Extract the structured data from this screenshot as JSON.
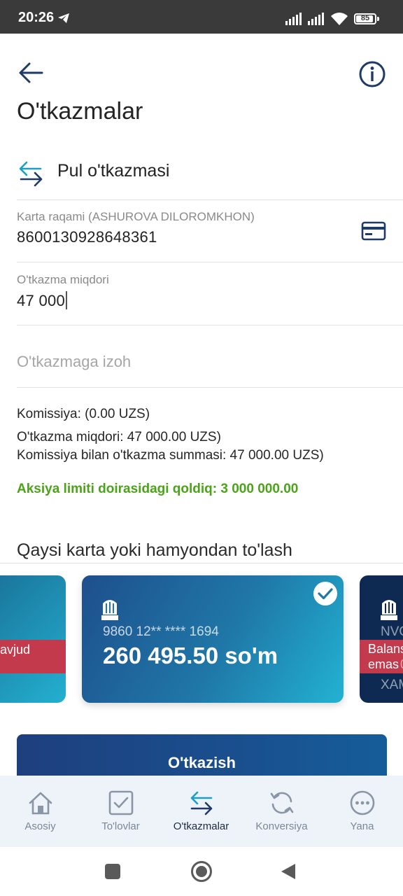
{
  "status_bar": {
    "time": "20:26",
    "battery": "85"
  },
  "header": {
    "title": "O'tkazmalar"
  },
  "section": {
    "title": "Pul o'tkazmasi"
  },
  "card_field": {
    "label": "Karta raqami (ASHUROVA DILOROMKHON)",
    "value": "8600130928648361"
  },
  "amount_field": {
    "label": "O'tkazma miqdori",
    "value": "47 000"
  },
  "comment_field": {
    "placeholder": "O'tkazmaga izoh"
  },
  "summary": {
    "commission": "Komissiya: (0.00 UZS)",
    "amount": "O'tkazma miqdori: 47 000.00 UZS)",
    "total": "Komissiya bilan o'tkazma summasi: 47 000.00 UZS)",
    "promo": "Aksiya limiti doirasidagi qoldiq: 3 000 000.00",
    "promo_color": "#4aa319"
  },
  "pay_from": {
    "heading": "Qaysi karta yoki hamyondan to'lash",
    "cards": [
      {
        "band_text": "avjud"
      },
      {
        "bank_logo": "NBU",
        "masked": "9860 12** **** 1694",
        "balance": "260 495.50 so'm",
        "selected": true
      },
      {
        "bank_logo": "NBU",
        "text_top": "NVO",
        "band_line1": "Balans",
        "band_line2": "emas",
        "band_overlay": "0",
        "text_bottom": "XAM"
      }
    ]
  },
  "submit": {
    "label": "O'tkazish"
  },
  "bottom_nav": {
    "items": [
      {
        "label": "Asosiy",
        "icon": "home-icon"
      },
      {
        "label": "To'lovlar",
        "icon": "checkbox-icon"
      },
      {
        "label": "O'tkazmalar",
        "icon": "transfer-icon",
        "active": true
      },
      {
        "label": "Konversiya",
        "icon": "refresh-icon"
      },
      {
        "label": "Yana",
        "icon": "more-icon"
      }
    ]
  },
  "colors": {
    "primary": "#1e3f7e",
    "accent": "#1a9bc2",
    "danger_band": "#c23a4c",
    "nav_bg": "#eef3f9"
  }
}
